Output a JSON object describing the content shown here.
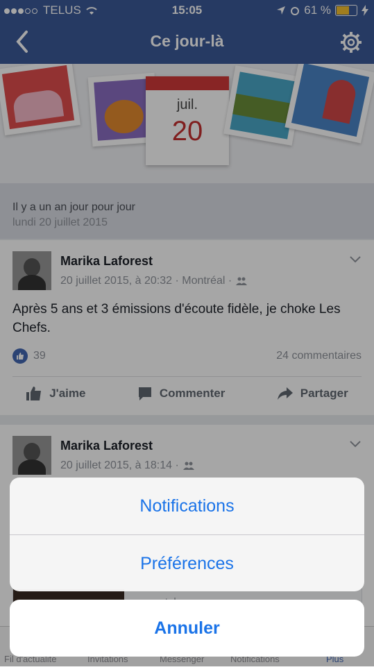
{
  "status_bar": {
    "carrier": "TELUS",
    "time": "15:05",
    "battery": "61 %"
  },
  "nav": {
    "title": "Ce jour-là"
  },
  "banner": {
    "month": "juil.",
    "day": "20"
  },
  "memory": {
    "headline": "Il y a un an jour pour jour",
    "date": "lundi 20 juillet 2015"
  },
  "posts": [
    {
      "author": "Marika Laforest",
      "meta": "20 juillet 2015, à 20:32 · Montréal ·",
      "text": "Après 5 ans et 3 émissions d'écoute fidèle, je choke Les Chefs.",
      "likes": "39",
      "comments": "24 commentaires"
    },
    {
      "author": "Marika Laforest",
      "meta": "20 juillet 2015, à 18:14 ·",
      "link_url": "m.youtube.com"
    }
  ],
  "actions": {
    "like": "J'aime",
    "comment": "Commenter",
    "share": "Partager"
  },
  "tabbar": {
    "tabs": [
      "Fil d'actualité",
      "Invitations",
      "Messenger",
      "Notifications",
      "Plus"
    ],
    "active_color": "#4267b2"
  },
  "action_sheet": {
    "option1": "Notifications",
    "option2": "Préférences",
    "cancel": "Annuler"
  },
  "colors": {
    "brand": "#3b5998",
    "sheet_text": "#1a73e8"
  }
}
